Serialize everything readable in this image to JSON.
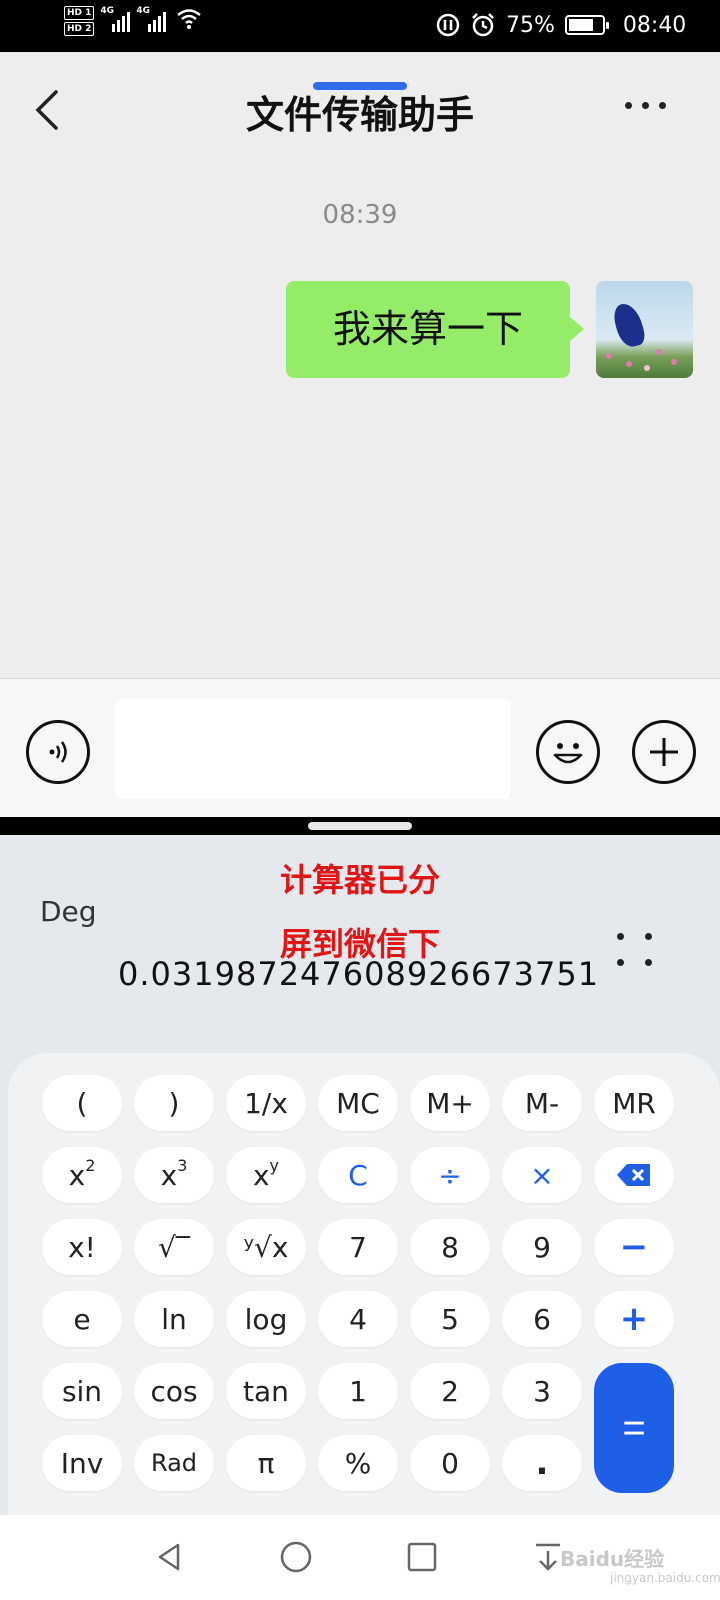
{
  "status_bar": {
    "sim1": "HD 1",
    "sim2": "HD 2",
    "network": "4G",
    "battery_percent": "75%",
    "battery_level": 0.75,
    "time": "08:40"
  },
  "chat": {
    "title": "文件传输助手",
    "timestamp": "08:39",
    "message": "我来算一下",
    "input_placeholder": ""
  },
  "calculator": {
    "annotation_line1": "计算器已分",
    "annotation_line2": "屏到微信下",
    "angle_mode": "Deg",
    "display": "0.031987247608926673751",
    "keys": {
      "paren_open": "(",
      "paren_close": ")",
      "reciprocal": "1/x",
      "mc": "MC",
      "mplus": "M+",
      "mminus": "M-",
      "mr": "MR",
      "x_base": "x",
      "sq_exp": "2",
      "cube_exp": "3",
      "pow_exp": "y",
      "clear": "C",
      "divide": "÷",
      "multiply": "×",
      "factorial": "x!",
      "sqrt": "√‾",
      "yroot": "ʸ√x",
      "k7": "7",
      "k8": "8",
      "k9": "9",
      "minus": "−",
      "e": "e",
      "ln": "ln",
      "log": "log",
      "k4": "4",
      "k5": "5",
      "k6": "6",
      "plus": "+",
      "sin": "sin",
      "cos": "cos",
      "tan": "tan",
      "k1": "1",
      "k2": "2",
      "k3": "3",
      "inv": "Inv",
      "rad": "Rad",
      "pi": "π",
      "percent": "%",
      "k0": "0",
      "dot": ".",
      "equals": "="
    }
  },
  "watermark": {
    "text": "Baidu经验",
    "sub": "jingyan.baidu.com"
  },
  "colors": {
    "accent_blue": "#1f5fe6",
    "bubble_green": "#95ec69",
    "annotation_red": "#e01616"
  },
  "icons": [
    "back-icon",
    "more-icon",
    "voice-icon",
    "emoji-icon",
    "plus-icon",
    "backspace-icon",
    "nav-back-icon",
    "nav-home-icon",
    "nav-recent-icon",
    "nav-dropdown-icon"
  ]
}
